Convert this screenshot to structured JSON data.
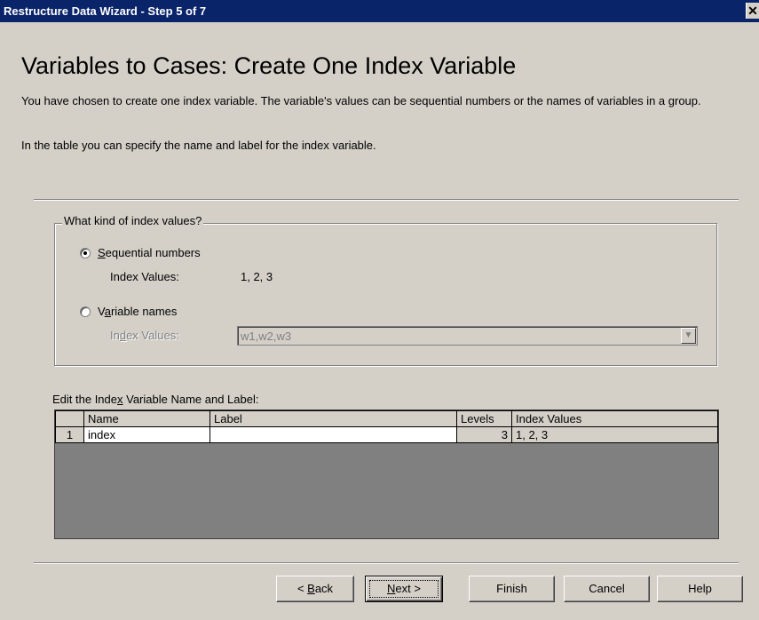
{
  "window": {
    "title": "Restructure Data Wizard - Step 5 of 7",
    "close_glyph": "✕"
  },
  "heading": "Variables to Cases: Create One Index Variable",
  "description": {
    "line1": "You have chosen to create one index variable.  The variable's values can be sequential numbers or the names of variables in a group.",
    "line2": "In the table you can specify the name and label for the index variable."
  },
  "index_kind": {
    "legend": "What kind of index values?",
    "sequential": {
      "label_pre": "",
      "label_accel": "S",
      "label_post": "equential numbers",
      "selected": true,
      "values_label": "Index Values:",
      "values": "1, 2, 3"
    },
    "variable_names": {
      "label_pre": "V",
      "label_accel": "a",
      "label_post": "riable names",
      "selected": false,
      "values_label_pre": "In",
      "values_label_accel": "d",
      "values_label_post": "ex Values:",
      "combo_value": "w1,w2,w3",
      "combo_arrow_icon": "chevron-down-icon"
    }
  },
  "table": {
    "label_pre": "Edit the Inde",
    "label_accel": "x",
    "label_post": " Variable Name and Label:",
    "columns": [
      "",
      "Name",
      "Label",
      "Levels",
      "Index Values"
    ],
    "rows": [
      {
        "num": "1",
        "name": "index",
        "label": "",
        "levels": "3",
        "index_values": "1, 2, 3"
      }
    ]
  },
  "buttons": {
    "back_pre": "< ",
    "back_accel": "B",
    "back_post": "ack",
    "next_pre": "",
    "next_accel": "N",
    "next_post": "ext >",
    "finish": "Finish",
    "cancel": "Cancel",
    "help": "Help"
  },
  "colors": {
    "titlebar": "#0a246a",
    "face": "#d4d0c8",
    "table_background": "#808080"
  }
}
